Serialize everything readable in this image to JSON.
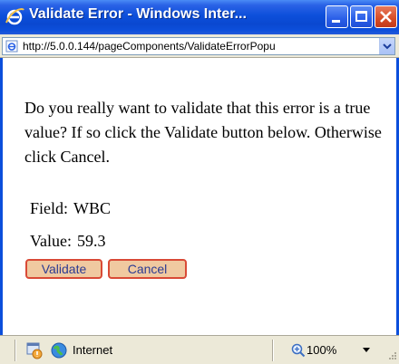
{
  "window": {
    "title": "Validate Error - Windows Inter...",
    "icon": "ie-icon",
    "controls": [
      "minimize-icon",
      "maximize-icon",
      "close-icon"
    ]
  },
  "address": {
    "url": "http://5.0.0.144/pageComponents/ValidateErrorPopu"
  },
  "content": {
    "message": "Do you really want to validate that this error is a true value? If so click the Validate button below. Otherwise click Cancel.",
    "field_label": "Field:",
    "field_value": "WBC",
    "value_label": "Value:",
    "value_value": "59.3",
    "validate_button": "Validate",
    "cancel_button": "Cancel"
  },
  "status": {
    "zone": "Internet",
    "zoom": "100%"
  },
  "colors": {
    "titlebar": "#0c4fdb",
    "button_bg": "#f0c9a0",
    "button_border": "#d94a36",
    "button_text": "#2c3b92"
  }
}
